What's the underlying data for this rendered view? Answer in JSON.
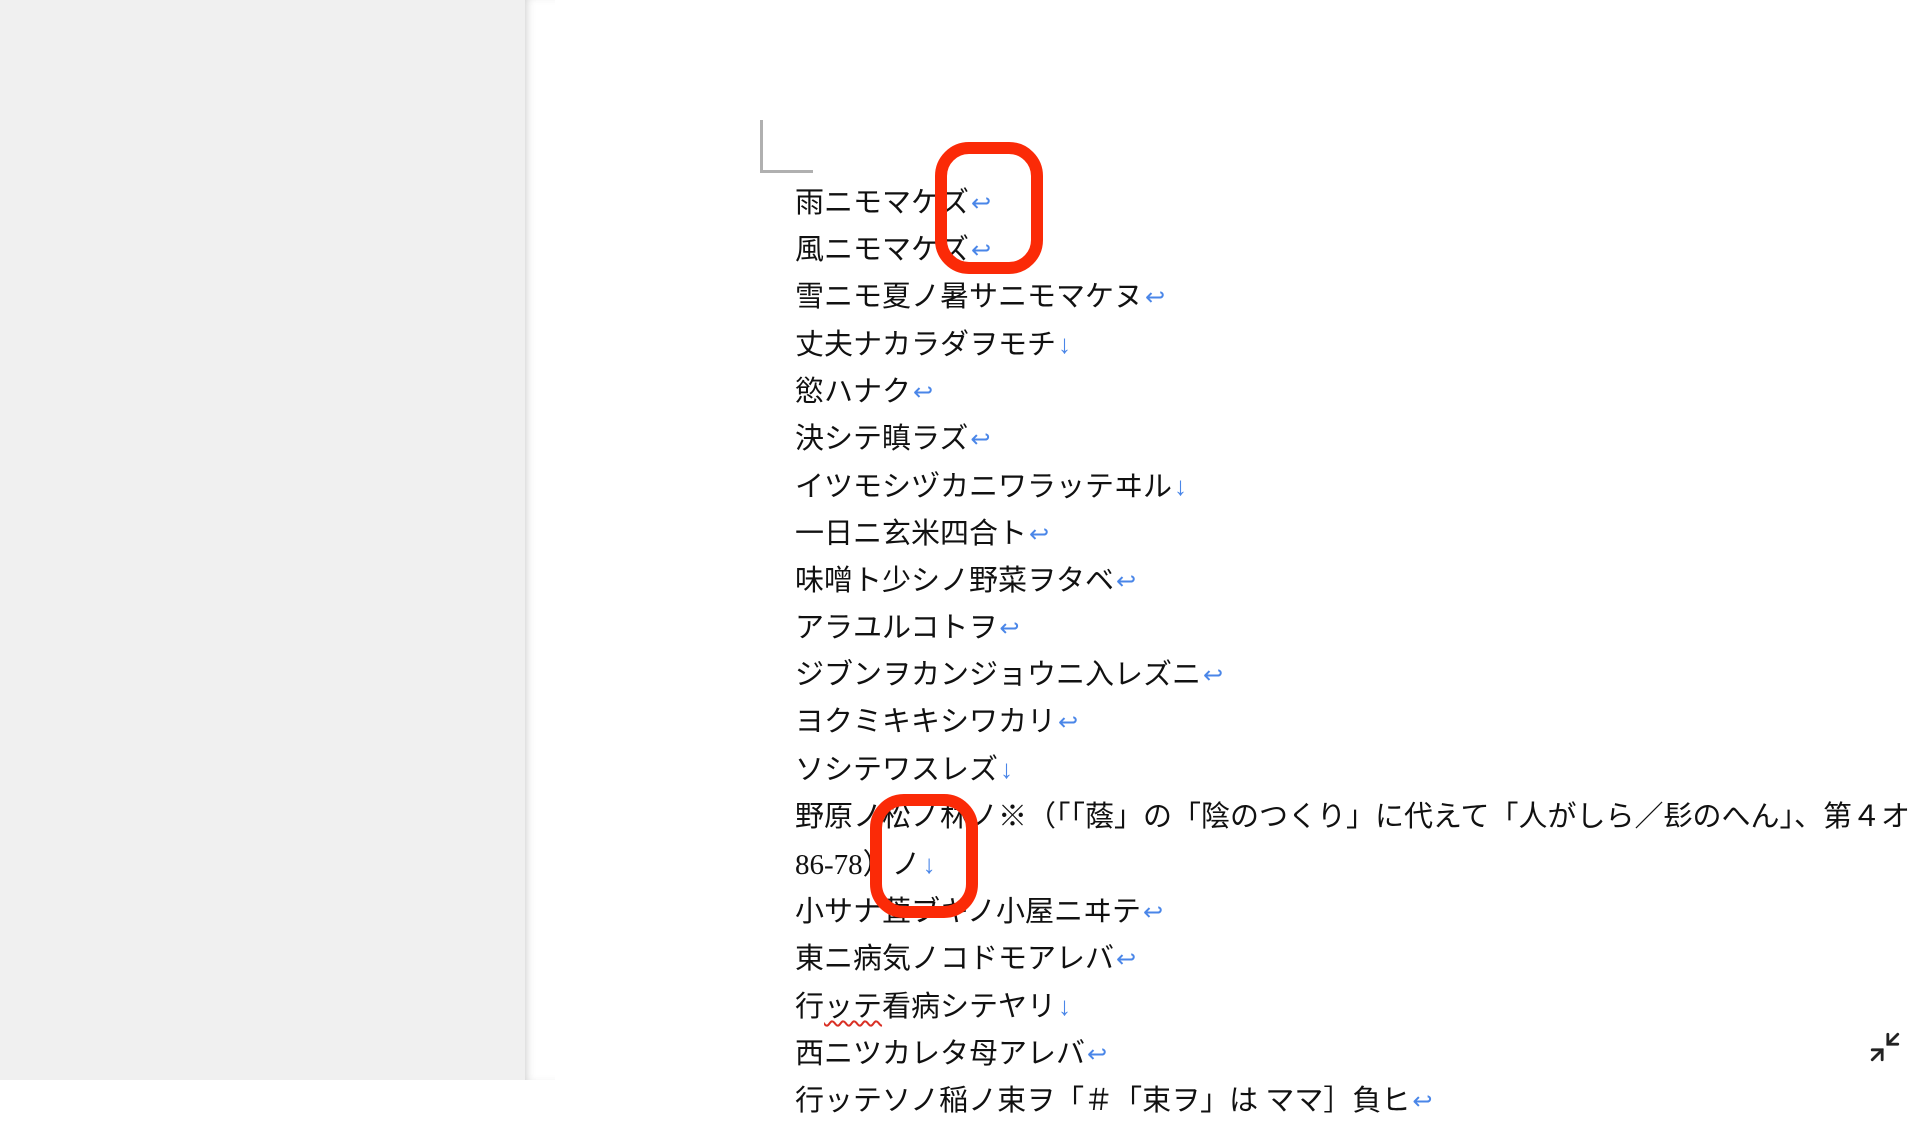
{
  "marks": {
    "pilcrow": "↩",
    "downarrow": "↓"
  },
  "lines": [
    {
      "text": "雨ニモマケズ",
      "mark": "pilcrow"
    },
    {
      "text": "風ニモマケズ",
      "mark": "pilcrow"
    },
    {
      "text": "雪ニモ夏ノ暑サニモマケヌ",
      "mark": "pilcrow"
    },
    {
      "text": "丈夫ナカラダヲモチ",
      "mark": "downarrow"
    },
    {
      "text": "慾ハナク",
      "mark": "pilcrow"
    },
    {
      "text": "決シテ瞋ラズ",
      "mark": "pilcrow"
    },
    {
      "text": "イツモシヅカニワラッテヰル",
      "mark": "downarrow"
    },
    {
      "text": "一日ニ玄米四合ト",
      "mark": "pilcrow"
    },
    {
      "text": "味噌ト少シノ野菜ヲタベ",
      "mark": "pilcrow"
    },
    {
      "text": "アラユルコトヲ",
      "mark": "pilcrow"
    },
    {
      "text": "ジブンヲカンジョウニ入レズニ",
      "mark": "pilcrow"
    },
    {
      "text": "ヨクミキキシワカリ",
      "mark": "pilcrow"
    },
    {
      "text": "ソシテワスレズ",
      "mark": "downarrow"
    },
    {
      "text": "野原ノ松ノ林ノ※（「「蔭」の「陰のつくり」に代えて「人がしら／髟のへん」、第４オ",
      "mark": ""
    },
    {
      "text": "86-78）ノ",
      "mark": "downarrow"
    },
    {
      "text": "小サナ萓ブキノ小屋ニヰテ",
      "mark": "pilcrow"
    },
    {
      "text": "東ニ病気ノコドモアレバ",
      "mark": "pilcrow"
    },
    {
      "pre": "行",
      "squiggle": "ッテ",
      "post": "看病シテヤリ",
      "mark": "downarrow"
    },
    {
      "text": "西ニツカレタ母アレバ",
      "mark": "pilcrow"
    },
    {
      "text": "行ッテソノ稲ノ束ヲ「＃「束ヲ」は ママ］負ヒ",
      "mark": "pilcrow"
    }
  ],
  "annotations": {
    "ring1": "highlight-ring-1",
    "ring2": "highlight-ring-2"
  },
  "controls": {
    "collapse": "collapse-view"
  }
}
